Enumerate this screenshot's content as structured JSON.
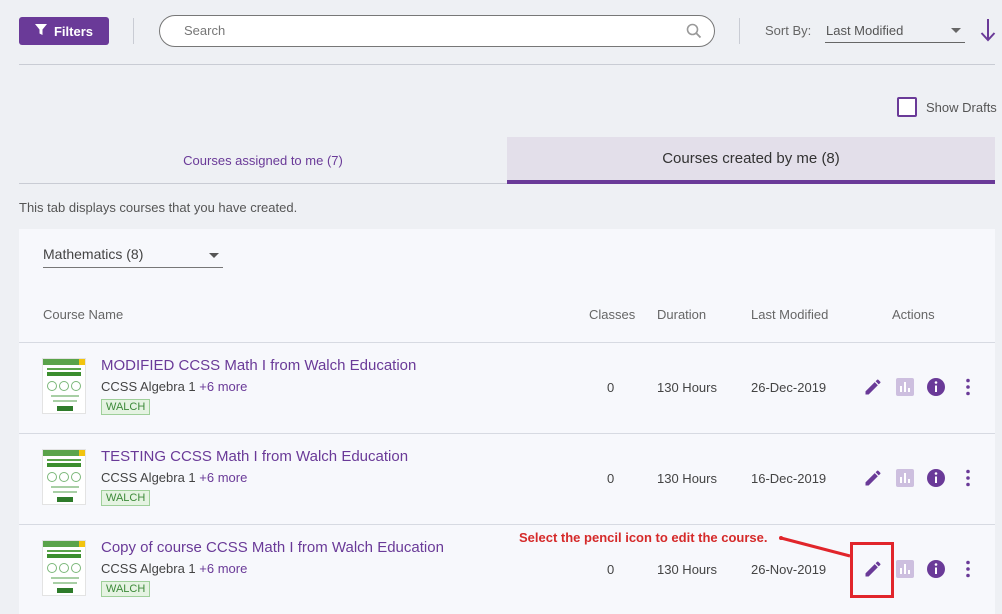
{
  "toolbar": {
    "filters_label": "Filters",
    "search_placeholder": "Search",
    "sort_label": "Sort By:",
    "sort_value": "Last Modified"
  },
  "show_drafts_label": "Show Drafts",
  "tabs": [
    {
      "label": "Courses assigned to me (7)",
      "active": false
    },
    {
      "label": "Courses created by me (8)",
      "active": true
    }
  ],
  "tab_description": "This tab displays courses that you have created.",
  "subject_filter": "Mathematics (8)",
  "table": {
    "headers": {
      "name": "Course Name",
      "classes": "Classes",
      "duration": "Duration",
      "modified": "Last Modified",
      "actions": "Actions"
    },
    "rows": [
      {
        "title": "MODIFIED CCSS Math I from Walch Education",
        "subject": "CCSS Algebra 1",
        "more": "+6 more",
        "badge": "WALCH",
        "classes": "0",
        "duration": "130 Hours",
        "modified": "26-Dec-2019"
      },
      {
        "title": "TESTING CCSS Math I from Walch Education",
        "subject": "CCSS Algebra 1",
        "more": "+6 more",
        "badge": "WALCH",
        "classes": "0",
        "duration": "130 Hours",
        "modified": "16-Dec-2019"
      },
      {
        "title": "Copy of course CCSS Math I from Walch Education",
        "subject": "CCSS Algebra 1",
        "more": "+6 more",
        "badge": "WALCH",
        "classes": "0",
        "duration": "130 Hours",
        "modified": "26-Nov-2019"
      }
    ]
  },
  "annotation": "Select the pencil icon to edit the course.",
  "colors": {
    "accent": "#6a3a98",
    "annotation": "#d52a2a",
    "badge_green": "#3d8a3a"
  },
  "icons": [
    "funnel-icon",
    "search-icon",
    "arrow-down-icon",
    "pencil-icon",
    "chart-icon",
    "info-icon",
    "more-vert-icon"
  ]
}
